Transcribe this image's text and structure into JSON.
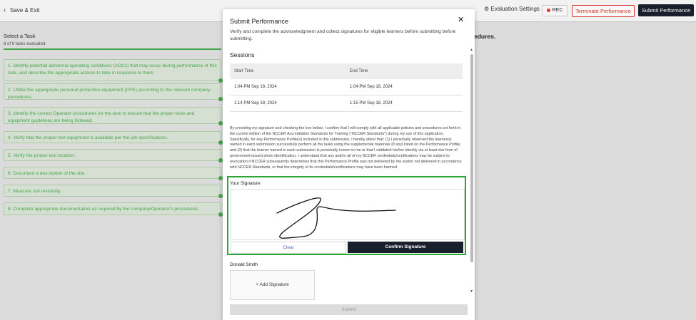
{
  "header": {
    "back_label": "Save & Exit",
    "evaluation_settings_label": "Evaluation Settings",
    "rec_label": "REC",
    "terminate_label": "Terminate Performance",
    "submit_label": "Submit Performance",
    "accent_color": "#1a1f2e",
    "danger_color": "#d9332b"
  },
  "left": {
    "title": "Select a Task",
    "subtitle": "8 of 8 tasks evaluated.",
    "tasks": [
      "1. Identify potential abnormal operating conditions (AOCs) that may occur during performance of this task, and describe the appropriate actions to take in response to them.",
      "2. Utilize the appropriate personal protective equipment (PPE) according to the relevant company procedures.",
      "3. Identify the correct Operator procedures for the task to ensure that the proper tools and equipment guidelines are being followed.",
      "4. Verify that the proper test equipment is available per the job specifications.",
      "5. Verify the proper test location.",
      "6. Document a description of the site.",
      "7. Measure soil resistivity.",
      "8. Complete appropriate documentation as required by the company/Operator's procedures."
    ]
  },
  "right_text": "edures.",
  "modal": {
    "title": "Submit Performance",
    "description": "Verify and complete the acknowledgment and collect signatures for eligible learners before submitting before submitting.",
    "sessions_title": "Sessions",
    "table": {
      "headers": [
        "Start Time",
        "End Time"
      ],
      "rows": [
        [
          "1:04 PM Sep 18, 2024",
          "1:04 PM Sep 18, 2024"
        ],
        [
          "1:14 PM Sep 18, 2024",
          "1:15 PM Sep 18, 2024"
        ]
      ]
    },
    "legal_text": "By providing my signature and checking the box below, I confirm that I will comply with all applicable policies and procedures set forth in the current edition of the NCCER Accreditation Standards for Training (\"NCCER Standards\") during my use of this application. Specifically, for any Performance Profile(s) included in this submission, I hereby attest that: (1) I personally observed the learner(s) named in each submission successfully perform all the tasks using the supplemental materials (if any) listed on the Performance Profile, and (2) that the learner named in each submission is personally known to me or that I validated his/her identity via at least one form of government-issued photo identification. I understand that any and/or all of my NCCER credentials/certifications may be subject to revocation if NCCER subsequently determines that this Performance Profile was not delivered by me and/or not delivered in accordance with NCCER Standards, or that the integrity of its credentials/certifications may have been harmed.",
    "signature_label": "Your Signature",
    "clear_label": "Clear",
    "confirm_label": "Confirm Signature",
    "person_name": "Donald Smith",
    "add_signature_label": "+ Add Signature",
    "submit_label": "Submit",
    "highlight_color": "#2aa63a"
  }
}
